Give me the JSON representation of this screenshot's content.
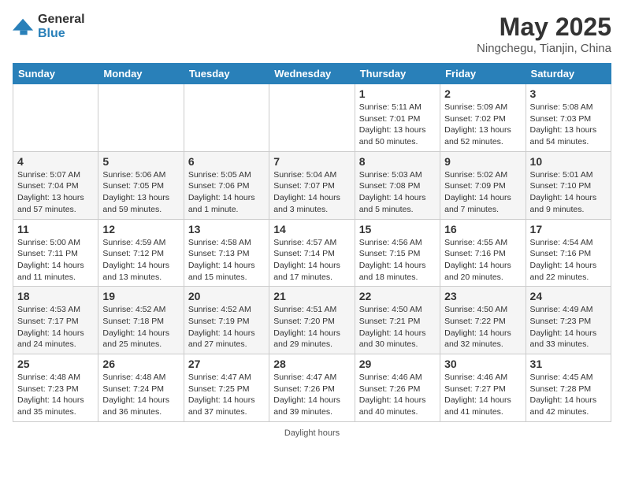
{
  "logo": {
    "general": "General",
    "blue": "Blue"
  },
  "title": "May 2025",
  "subtitle": "Ningchegu, Tianjin, China",
  "headers": [
    "Sunday",
    "Monday",
    "Tuesday",
    "Wednesday",
    "Thursday",
    "Friday",
    "Saturday"
  ],
  "footer": "Daylight hours",
  "weeks": [
    [
      {
        "day": "",
        "text": ""
      },
      {
        "day": "",
        "text": ""
      },
      {
        "day": "",
        "text": ""
      },
      {
        "day": "",
        "text": ""
      },
      {
        "day": "1",
        "text": "Sunrise: 5:11 AM\nSunset: 7:01 PM\nDaylight: 13 hours\nand 50 minutes."
      },
      {
        "day": "2",
        "text": "Sunrise: 5:09 AM\nSunset: 7:02 PM\nDaylight: 13 hours\nand 52 minutes."
      },
      {
        "day": "3",
        "text": "Sunrise: 5:08 AM\nSunset: 7:03 PM\nDaylight: 13 hours\nand 54 minutes."
      }
    ],
    [
      {
        "day": "4",
        "text": "Sunrise: 5:07 AM\nSunset: 7:04 PM\nDaylight: 13 hours\nand 57 minutes."
      },
      {
        "day": "5",
        "text": "Sunrise: 5:06 AM\nSunset: 7:05 PM\nDaylight: 13 hours\nand 59 minutes."
      },
      {
        "day": "6",
        "text": "Sunrise: 5:05 AM\nSunset: 7:06 PM\nDaylight: 14 hours\nand 1 minute."
      },
      {
        "day": "7",
        "text": "Sunrise: 5:04 AM\nSunset: 7:07 PM\nDaylight: 14 hours\nand 3 minutes."
      },
      {
        "day": "8",
        "text": "Sunrise: 5:03 AM\nSunset: 7:08 PM\nDaylight: 14 hours\nand 5 minutes."
      },
      {
        "day": "9",
        "text": "Sunrise: 5:02 AM\nSunset: 7:09 PM\nDaylight: 14 hours\nand 7 minutes."
      },
      {
        "day": "10",
        "text": "Sunrise: 5:01 AM\nSunset: 7:10 PM\nDaylight: 14 hours\nand 9 minutes."
      }
    ],
    [
      {
        "day": "11",
        "text": "Sunrise: 5:00 AM\nSunset: 7:11 PM\nDaylight: 14 hours\nand 11 minutes."
      },
      {
        "day": "12",
        "text": "Sunrise: 4:59 AM\nSunset: 7:12 PM\nDaylight: 14 hours\nand 13 minutes."
      },
      {
        "day": "13",
        "text": "Sunrise: 4:58 AM\nSunset: 7:13 PM\nDaylight: 14 hours\nand 15 minutes."
      },
      {
        "day": "14",
        "text": "Sunrise: 4:57 AM\nSunset: 7:14 PM\nDaylight: 14 hours\nand 17 minutes."
      },
      {
        "day": "15",
        "text": "Sunrise: 4:56 AM\nSunset: 7:15 PM\nDaylight: 14 hours\nand 18 minutes."
      },
      {
        "day": "16",
        "text": "Sunrise: 4:55 AM\nSunset: 7:16 PM\nDaylight: 14 hours\nand 20 minutes."
      },
      {
        "day": "17",
        "text": "Sunrise: 4:54 AM\nSunset: 7:16 PM\nDaylight: 14 hours\nand 22 minutes."
      }
    ],
    [
      {
        "day": "18",
        "text": "Sunrise: 4:53 AM\nSunset: 7:17 PM\nDaylight: 14 hours\nand 24 minutes."
      },
      {
        "day": "19",
        "text": "Sunrise: 4:52 AM\nSunset: 7:18 PM\nDaylight: 14 hours\nand 25 minutes."
      },
      {
        "day": "20",
        "text": "Sunrise: 4:52 AM\nSunset: 7:19 PM\nDaylight: 14 hours\nand 27 minutes."
      },
      {
        "day": "21",
        "text": "Sunrise: 4:51 AM\nSunset: 7:20 PM\nDaylight: 14 hours\nand 29 minutes."
      },
      {
        "day": "22",
        "text": "Sunrise: 4:50 AM\nSunset: 7:21 PM\nDaylight: 14 hours\nand 30 minutes."
      },
      {
        "day": "23",
        "text": "Sunrise: 4:50 AM\nSunset: 7:22 PM\nDaylight: 14 hours\nand 32 minutes."
      },
      {
        "day": "24",
        "text": "Sunrise: 4:49 AM\nSunset: 7:23 PM\nDaylight: 14 hours\nand 33 minutes."
      }
    ],
    [
      {
        "day": "25",
        "text": "Sunrise: 4:48 AM\nSunset: 7:23 PM\nDaylight: 14 hours\nand 35 minutes."
      },
      {
        "day": "26",
        "text": "Sunrise: 4:48 AM\nSunset: 7:24 PM\nDaylight: 14 hours\nand 36 minutes."
      },
      {
        "day": "27",
        "text": "Sunrise: 4:47 AM\nSunset: 7:25 PM\nDaylight: 14 hours\nand 37 minutes."
      },
      {
        "day": "28",
        "text": "Sunrise: 4:47 AM\nSunset: 7:26 PM\nDaylight: 14 hours\nand 39 minutes."
      },
      {
        "day": "29",
        "text": "Sunrise: 4:46 AM\nSunset: 7:26 PM\nDaylight: 14 hours\nand 40 minutes."
      },
      {
        "day": "30",
        "text": "Sunrise: 4:46 AM\nSunset: 7:27 PM\nDaylight: 14 hours\nand 41 minutes."
      },
      {
        "day": "31",
        "text": "Sunrise: 4:45 AM\nSunset: 7:28 PM\nDaylight: 14 hours\nand 42 minutes."
      }
    ]
  ]
}
